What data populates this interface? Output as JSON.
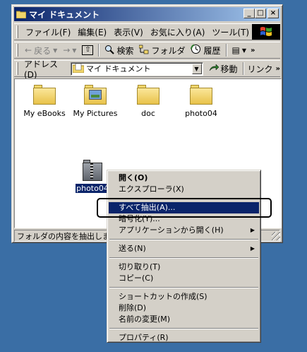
{
  "window": {
    "title": "マイ ドキュメント",
    "controls": {
      "minimize": "_",
      "maximize": "□",
      "close": "×"
    }
  },
  "menubar": {
    "items": [
      "ファイル(F)",
      "編集(E)",
      "表示(V)",
      "お気に入り(A)",
      "ツール(T)"
    ],
    "more": "»"
  },
  "toolbar": {
    "back": "戻る",
    "back_arrow": "←",
    "forward_arrow": "→",
    "up_icon": "⇧",
    "search": "検索",
    "folders": "フォルダ",
    "history": "履歴",
    "views_icon": "▤",
    "more": "»"
  },
  "addressbar": {
    "label": "アドレス(D)",
    "value": "マイ ドキュメント",
    "go": "移動",
    "links": "リンク",
    "more": "»"
  },
  "files": [
    {
      "name": "My eBooks",
      "icon": "folder-icon"
    },
    {
      "name": "My Pictures",
      "icon": "pictures-folder-icon"
    },
    {
      "name": "doc",
      "icon": "folder-icon"
    },
    {
      "name": "photo04",
      "icon": "folder-icon"
    },
    {
      "name": "photo04",
      "icon": "zip-folder-icon",
      "selected": true
    }
  ],
  "status": "フォルダの内容を抽出します",
  "context_menu": [
    {
      "label": "開く(O)",
      "bold": true
    },
    {
      "label": "エクスプローラ(X)"
    },
    {
      "separator": true
    },
    {
      "label": "すべて抽出(A)...",
      "highlighted": true
    },
    {
      "label": "暗号化(Y)..."
    },
    {
      "label": "アプリケーションから開く(H)",
      "submenu": true
    },
    {
      "separator": true
    },
    {
      "label": "送る(N)",
      "submenu": true
    },
    {
      "separator": true
    },
    {
      "label": "切り取り(T)"
    },
    {
      "label": "コピー(C)"
    },
    {
      "separator": true
    },
    {
      "label": "ショートカットの作成(S)"
    },
    {
      "label": "削除(D)"
    },
    {
      "label": "名前の変更(M)"
    },
    {
      "separator": true
    },
    {
      "label": "プロパティ(R)"
    }
  ],
  "colors": {
    "desktop": "#3a6ea5",
    "title_active": "#0a246a",
    "highlight": "#0a246a",
    "face": "#d4d0c8"
  }
}
